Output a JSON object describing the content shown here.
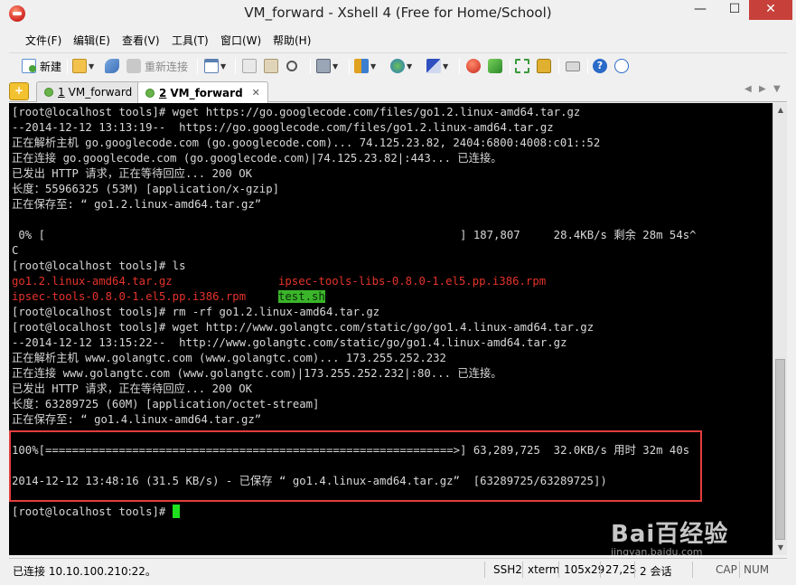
{
  "window": {
    "title": "VM_forward - Xshell 4 (Free for Home/School)",
    "minimize_glyph": "—",
    "maximize_glyph": "☐",
    "close_glyph": "✕"
  },
  "menu": {
    "items": [
      {
        "label": "文件(F)"
      },
      {
        "label": "编辑(E)"
      },
      {
        "label": "查看(V)"
      },
      {
        "label": "工具(T)"
      },
      {
        "label": "窗口(W)"
      },
      {
        "label": "帮助(H)"
      }
    ]
  },
  "toolbar": {
    "new_label": "新建",
    "reconnect_label": "重新连接",
    "icons": [
      "new-session-icon",
      "open-folder-icon",
      "connect-icon",
      "reconnect-icon",
      "properties-icon",
      "copy-icon",
      "paste-icon",
      "find-icon",
      "print-icon",
      "transfer-icon",
      "globe-icon",
      "font-icon",
      "xftp-icon",
      "xmanager-icon",
      "fullscreen-icon",
      "lock-icon",
      "keyboard-icon",
      "help-icon",
      "chat-icon"
    ]
  },
  "tabs": {
    "add_glyph": "+",
    "items": [
      {
        "number": "1",
        "label": "VM_forward",
        "active": false
      },
      {
        "number": "2",
        "label": "VM_forward",
        "active": true
      }
    ],
    "close_glyph": "✕",
    "prev_glyph": "◀",
    "next_glyph": "▶",
    "menu_glyph": "▼"
  },
  "terminal": {
    "lines": [
      "[root@localhost tools]# wget https://go.googlecode.com/files/go1.2.linux-amd64.tar.gz",
      "--2014-12-12 13:13:19--  https://go.googlecode.com/files/go1.2.linux-amd64.tar.gz",
      "正在解析主机 go.googlecode.com (go.googlecode.com)... 74.125.23.82, 2404:6800:4008:c01::52",
      "正在连接 go.googlecode.com (go.googlecode.com)|74.125.23.82|:443... 已连接。",
      "已发出 HTTP 请求，正在等待回应... 200 OK",
      "长度：55966325 (53M) [application/x-gzip]",
      "正在保存至: “ go1.2.linux-amd64.tar.gz”",
      "",
      " 0% [                                                              ] 187,807     28.4KB/s 剩余 28m 54s^",
      "C",
      "[root@localhost tools]# ls"
    ],
    "ls_output": {
      "col1_row1": "go1.2.linux-amd64.tar.gz",
      "col2_row1": "ipsec-tools-libs-0.8.0-1.el5.pp.i386.rpm",
      "col1_row2": "ipsec-tools-0.8.0-1.el5.pp.i386.rpm",
      "col2_row2": "test.sh"
    },
    "lines_after": [
      "[root@localhost tools]# rm -rf go1.2.linux-amd64.tar.gz",
      "[root@localhost tools]# wget http://www.golangtc.com/static/go/go1.4.linux-amd64.tar.gz",
      "--2014-12-12 13:15:22--  http://www.golangtc.com/static/go/go1.4.linux-amd64.tar.gz",
      "正在解析主机 www.golangtc.com (www.golangtc.com)... 173.255.252.232",
      "正在连接 www.golangtc.com (www.golangtc.com)|173.255.252.232|:80... 已连接。",
      "已发出 HTTP 请求，正在等待回应... 200 OK",
      "长度：63289725 (60M) [application/octet-stream]",
      "正在保存至: “ go1.4.linux-amd64.tar.gz”",
      "",
      "100%[=============================================================>] 63,289,725  32.0KB/s 用时 32m 40s",
      "",
      "2014-12-12 13:48:16 (31.5 KB/s) - 已保存 “ go1.4.linux-amd64.tar.gz”  [63289725/63289725])",
      "",
      "[root@localhost tools]# "
    ]
  },
  "scrollbar": {
    "up_glyph": "▲",
    "down_glyph": "▼"
  },
  "status": {
    "connection": "已连接 10.10.100.210:22。",
    "protocol": "SSH2",
    "terminal_type": "xterm",
    "size": "105x29",
    "cursor_pos": "27,25",
    "sessions": "2 会话",
    "caps": "CAP",
    "num": "NUM"
  },
  "watermark": {
    "main": "Bai百经验",
    "sub": "jingyan.baidu.com"
  },
  "colors": {
    "terminal_bg": "#000000",
    "terminal_fg": "#d8d8d8",
    "ls_red": "#e5332a",
    "ls_green_bg": "#3bb52a",
    "highlight_border": "#e23d3d",
    "cursor": "#1de21d"
  }
}
